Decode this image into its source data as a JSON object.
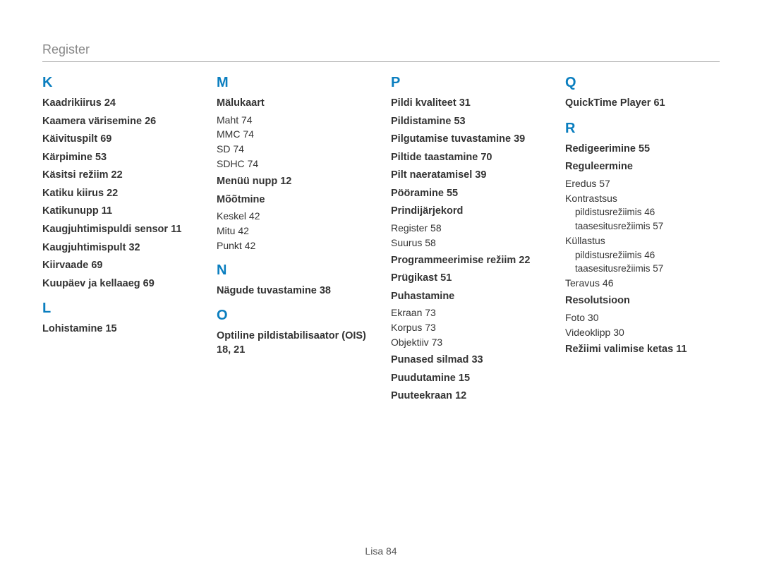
{
  "header": {
    "title": "Register"
  },
  "footer": {
    "label": "Lisa",
    "page": "84"
  },
  "columns": [
    {
      "sections": [
        {
          "letter": "K",
          "entries": [
            {
              "label": "Kaadrikiirus",
              "pages": "24"
            },
            {
              "label": "Kaamera värisemine",
              "pages": "26"
            },
            {
              "label": "Käivituspilt",
              "pages": "69"
            },
            {
              "label": "Kärpimine",
              "pages": "53"
            },
            {
              "label": "Käsitsi režiim",
              "pages": "22"
            },
            {
              "label": "Katiku kiirus",
              "pages": "22"
            },
            {
              "label": "Katikunupp",
              "pages": "11"
            },
            {
              "label": "Kaugjuhtimispuldi sensor",
              "pages": "11"
            },
            {
              "label": "Kaugjuhtimispult",
              "pages": "32"
            },
            {
              "label": "Kiirvaade",
              "pages": "69"
            },
            {
              "label": "Kuupäev ja kellaaeg",
              "pages": "69"
            }
          ]
        },
        {
          "letter": "L",
          "entries": [
            {
              "label": "Lohistamine",
              "pages": "15"
            }
          ]
        }
      ]
    },
    {
      "sections": [
        {
          "letter": "M",
          "entries": [
            {
              "label": "Mälukaart",
              "pages": "",
              "subs": [
                {
                  "label": "Maht",
                  "pages": "74"
                },
                {
                  "label": "MMC",
                  "pages": "74"
                },
                {
                  "label": "SD",
                  "pages": "74"
                },
                {
                  "label": "SDHC",
                  "pages": "74"
                }
              ]
            },
            {
              "label": "Menüü nupp",
              "pages": "12"
            },
            {
              "label": "Mõõtmine",
              "pages": "",
              "subs": [
                {
                  "label": "Keskel",
                  "pages": "42"
                },
                {
                  "label": "Mitu",
                  "pages": "42"
                },
                {
                  "label": "Punkt",
                  "pages": "42"
                }
              ]
            }
          ]
        },
        {
          "letter": "N",
          "entries": [
            {
              "label": "Nägude tuvastamine",
              "pages": "38"
            }
          ]
        },
        {
          "letter": "O",
          "entries": [
            {
              "label": "Optiline pildistabilisaator (OIS)",
              "pages": "18, 21"
            }
          ]
        }
      ]
    },
    {
      "sections": [
        {
          "letter": "P",
          "entries": [
            {
              "label": "Pildi kvaliteet",
              "pages": "31"
            },
            {
              "label": "Pildistamine",
              "pages": "53"
            },
            {
              "label": "Pilgutamise tuvastamine",
              "pages": "39"
            },
            {
              "label": "Piltide taastamine",
              "pages": "70"
            },
            {
              "label": "Pilt naeratamisel",
              "pages": "39"
            },
            {
              "label": "Pööramine",
              "pages": "55"
            },
            {
              "label": "Prindijärjekord",
              "pages": "",
              "subs": [
                {
                  "label": "Register",
                  "pages": "58"
                },
                {
                  "label": "Suurus",
                  "pages": "58"
                }
              ]
            },
            {
              "label": "Programmeerimise režiim",
              "pages": "22"
            },
            {
              "label": "Prügikast",
              "pages": "51"
            },
            {
              "label": "Puhastamine",
              "pages": "",
              "subs": [
                {
                  "label": "Ekraan",
                  "pages": "73"
                },
                {
                  "label": "Korpus",
                  "pages": "73"
                },
                {
                  "label": "Objektiiv",
                  "pages": "73"
                }
              ]
            },
            {
              "label": "Punased silmad",
              "pages": "33"
            },
            {
              "label": "Puudutamine",
              "pages": "15"
            },
            {
              "label": "Puuteekraan",
              "pages": "12"
            }
          ]
        }
      ]
    },
    {
      "sections": [
        {
          "letter": "Q",
          "entries": [
            {
              "label": "QuickTime Player",
              "pages": "61"
            }
          ]
        },
        {
          "letter": "R",
          "entries": [
            {
              "label": "Redigeerimine",
              "pages": "55"
            },
            {
              "label": "Reguleermine",
              "pages": "",
              "subs": [
                {
                  "label": "Eredus",
                  "pages": "57"
                },
                {
                  "label": "Kontrastsus",
                  "pages": "",
                  "subsubs": [
                    {
                      "label": "pildistusrežiimis",
                      "pages": "46"
                    },
                    {
                      "label": "taasesitusrežiimis",
                      "pages": "57"
                    }
                  ]
                },
                {
                  "label": "Küllastus",
                  "pages": "",
                  "subsubs": [
                    {
                      "label": "pildistusrežiimis",
                      "pages": "46"
                    },
                    {
                      "label": "taasesitusrežiimis",
                      "pages": "57"
                    }
                  ]
                },
                {
                  "label": "Teravus",
                  "pages": "46"
                }
              ]
            },
            {
              "label": "Resolutsioon",
              "pages": "",
              "subs": [
                {
                  "label": "Foto",
                  "pages": "30"
                },
                {
                  "label": "Videoklipp",
                  "pages": "30"
                }
              ]
            },
            {
              "label": "Režiimi valimise ketas",
              "pages": "11"
            }
          ]
        }
      ]
    }
  ]
}
